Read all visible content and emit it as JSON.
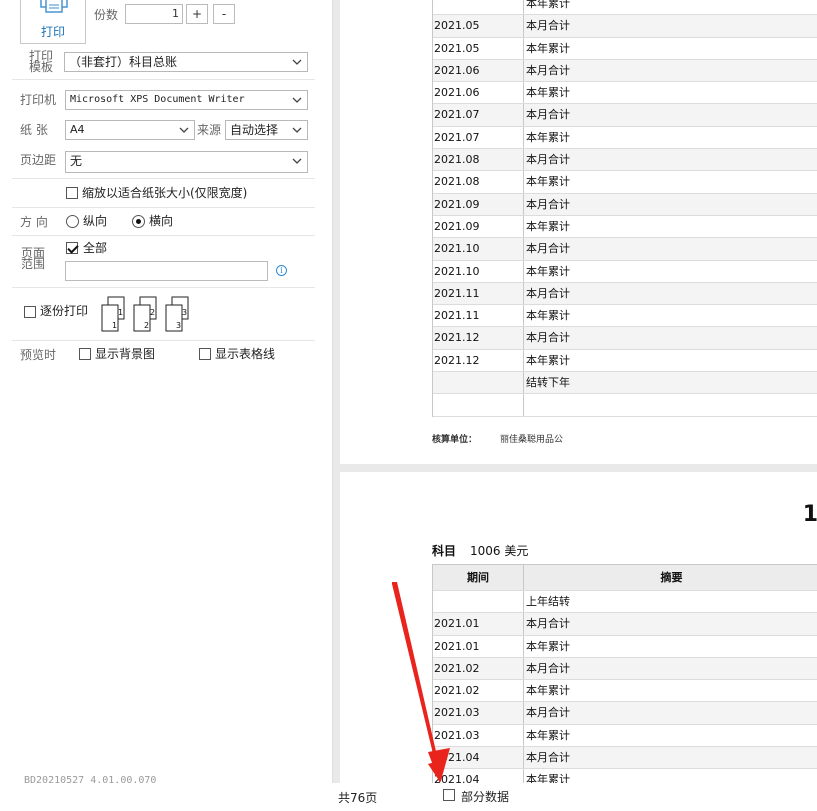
{
  "panel": {
    "print_label": "打印",
    "copies_label": "份数",
    "copies_value": "1",
    "plus": "+",
    "minus": "-",
    "template_label_1": "打印",
    "template_label_2": "模板",
    "template_value": "（非套打）科目总账",
    "printer_label": "打印机",
    "printer_value": "Microsoft XPS Document Writer",
    "paper_label": "纸 张",
    "paper_value": "A4",
    "source_label": "来源",
    "source_value": "自动选择",
    "margin_label": "页边距",
    "margin_value": "无",
    "fit_label": "缩放以适合纸张大小(仅限宽度)",
    "direction_label": "方 向",
    "portrait_label": "纵向",
    "landscape_label": "横向",
    "range_label_1": "页面",
    "range_label_2": "范围",
    "all_label": "全部",
    "collate_label": "逐份打印",
    "preview_label": "预览时",
    "show_bg_label": "显示背景图",
    "show_grid_label": "显示表格线",
    "version": "BD20210527 4.01.00.070",
    "info_glyph": "i"
  },
  "sheet1": {
    "rows": [
      {
        "period": "",
        "summary": "本年累计"
      },
      {
        "period": "2021.05",
        "summary": "本月合计"
      },
      {
        "period": "2021.05",
        "summary": "本年累计"
      },
      {
        "period": "2021.06",
        "summary": "本月合计"
      },
      {
        "period": "2021.06",
        "summary": "本年累计"
      },
      {
        "period": "2021.07",
        "summary": "本月合计"
      },
      {
        "period": "2021.07",
        "summary": "本年累计"
      },
      {
        "period": "2021.08",
        "summary": "本月合计"
      },
      {
        "period": "2021.08",
        "summary": "本年累计"
      },
      {
        "period": "2021.09",
        "summary": "本月合计"
      },
      {
        "period": "2021.09",
        "summary": "本年累计"
      },
      {
        "period": "2021.10",
        "summary": "本月合计"
      },
      {
        "period": "2021.10",
        "summary": "本年累计"
      },
      {
        "period": "2021.11",
        "summary": "本月合计"
      },
      {
        "period": "2021.11",
        "summary": "本年累计"
      },
      {
        "period": "2021.12",
        "summary": "本月合计"
      },
      {
        "period": "2021.12",
        "summary": "本年累计"
      },
      {
        "period": "",
        "summary": "结转下年"
      },
      {
        "period": "",
        "summary": ""
      }
    ],
    "footer_label": "核算单位：",
    "footer_value": "丽佳桑聪用品公"
  },
  "sheet2": {
    "page_mark": "1",
    "subject_label": "科目",
    "subject_value": "1006 美元",
    "header_period": "期间",
    "header_summary": "摘要",
    "rows": [
      {
        "period": "",
        "summary": "上年结转"
      },
      {
        "period": "2021.01",
        "summary": "本月合计"
      },
      {
        "period": "2021.01",
        "summary": "本年累计"
      },
      {
        "period": "2021.02",
        "summary": "本月合计"
      },
      {
        "period": "2021.02",
        "summary": "本年累计"
      },
      {
        "period": "2021.03",
        "summary": "本月合计"
      },
      {
        "period": "2021.03",
        "summary": "本年累计"
      },
      {
        "period": "2021.04",
        "summary": "本月合计"
      },
      {
        "period": "2021.04",
        "summary": "本年累计"
      }
    ]
  },
  "status": {
    "total_pages": "共76页",
    "partial_label": "部分数据"
  },
  "colors": {
    "accent": "#1a73b8",
    "arrow": "#e8241c"
  }
}
